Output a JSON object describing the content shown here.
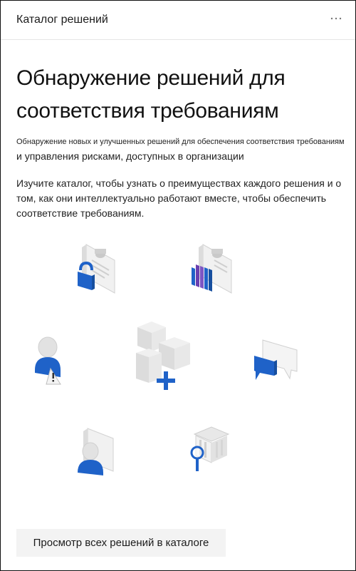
{
  "header": {
    "title": "Каталог решений",
    "more_icon": "more-horizontal-icon"
  },
  "hero": {
    "title": "Обнаружение решений для соответствия требованиям"
  },
  "intro": {
    "line1": "Обнаружение новых и улучшенных решений для обеспечения соответствия требованиям",
    "line2": "и управления рисками, доступных в организации"
  },
  "description": {
    "text": "Изучите каталог, чтобы узнать о преимуществах каждого решения и о том, как они интеллектуально работают вместе, чтобы обеспечить соответствие требованиям."
  },
  "illustrations": [
    "document-lock-icon",
    "document-books-icon",
    "user-warning-icon",
    "cubes-add-icon",
    "chat-bubbles-icon",
    "document-user-icon",
    "building-search-icon"
  ],
  "colors": {
    "accent_blue": "#1f62c8",
    "border": "#101010",
    "button_bg": "#f3f3f3"
  },
  "cta": {
    "label": "Просмотр всех решений в каталоге"
  }
}
